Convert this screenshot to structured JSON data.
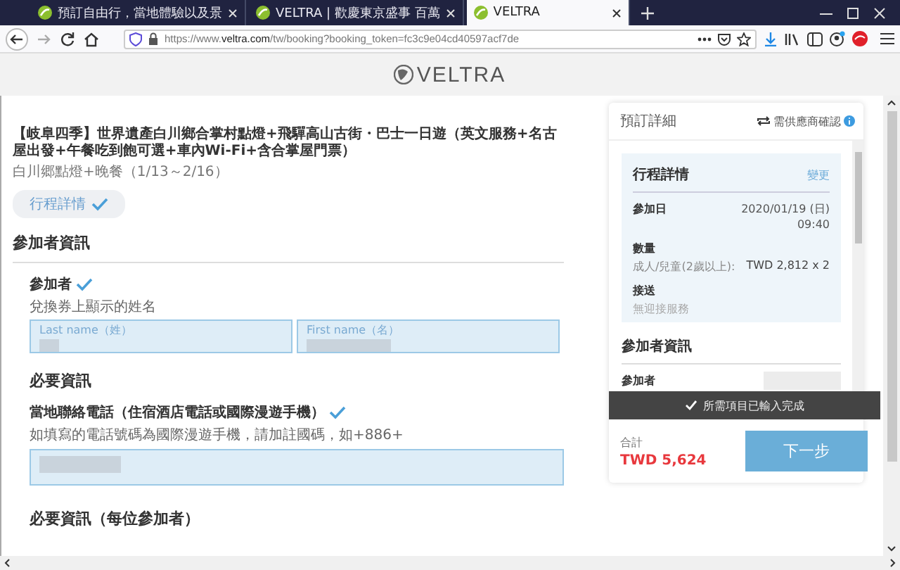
{
  "browser": {
    "tabs": [
      {
        "title": "預訂自由行，當地體驗以及景",
        "selected": false
      },
      {
        "title": "VELTRA | 歡慶東京盛事 百萬",
        "selected": false
      },
      {
        "title": "VELTRA",
        "selected": true
      }
    ],
    "address": {
      "host": "https://www.veltra.com",
      "path": "/tw/booking?booking_token=fc3c9e04cd40597acf7de"
    }
  },
  "site": {
    "logo": "VELTRA"
  },
  "tour": {
    "title": "【岐阜四季】世界遺產白川鄉合掌村點燈+飛驒高山古街・巴士一日遊（英文服務+名古屋出發+午餐吃到飽可選+車內Wi-Fi+含合掌屋門票）",
    "option": "白川郷點燈+晚餐（1/13～2/16）",
    "details_button": "行程詳情"
  },
  "participants": {
    "heading": "參加者資訊",
    "label": "參加者",
    "complete": true,
    "hint": "兌換券上顯示的姓名",
    "fields": [
      {
        "label": "Last name（姓）",
        "filled": true
      },
      {
        "label": "First name（名）",
        "filled": true
      }
    ]
  },
  "required": {
    "heading": "必要資訊",
    "label": "當地聯絡電話（住宿酒店電話或國際漫遊手機）",
    "complete": true,
    "hint": "如填寫的電話號碼為國際漫遊手機，請加註國碼，如+886+",
    "filled": true
  },
  "per_participant": {
    "heading": "必要資訊（每位參加者）"
  },
  "summary": {
    "title": "預訂詳細",
    "confirmation": "需供應商確認",
    "itinerary": {
      "heading": "行程詳情",
      "change_link": "變更",
      "groups": [
        {
          "label": "參加日",
          "value": "2020/01/19 (日)\n09:40"
        },
        {
          "label": "數量",
          "rows": [
            {
              "label": "成人/兒童(2歲以上):",
              "value": "TWD 2,812 x 2"
            }
          ]
        },
        {
          "label": "接送",
          "note": "無迎接服務"
        }
      ]
    },
    "participants_heading": "參加者資訊",
    "participant_label": "參加者",
    "status": "所需項目已輸入完成",
    "total_label": "合計",
    "total": "TWD 5,624",
    "next_button": "下一步"
  }
}
